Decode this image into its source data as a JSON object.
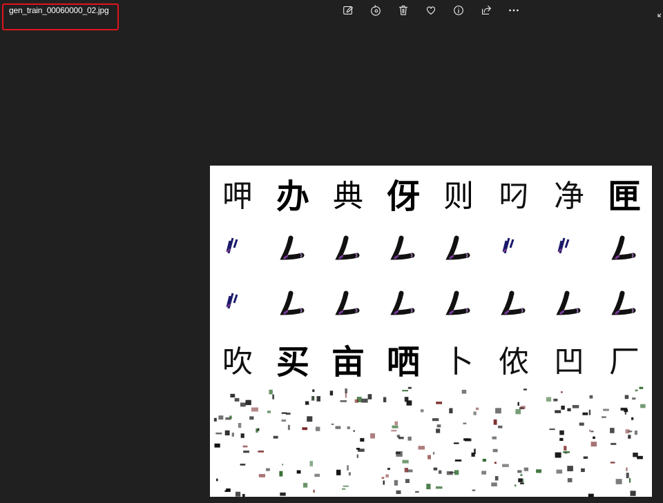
{
  "window": {
    "filename": "gen_train_00060000_02.jpg"
  },
  "toolbar": {
    "buttons": [
      {
        "name": "edit-image-icon"
      },
      {
        "name": "rotate-icon"
      },
      {
        "name": "delete-icon"
      },
      {
        "name": "favorite-heart-icon"
      },
      {
        "name": "info-icon"
      },
      {
        "name": "share-icon"
      },
      {
        "name": "more-options-icon"
      }
    ]
  },
  "image": {
    "rows": [
      [
        "呷",
        "办",
        "典",
        "伢",
        "则",
        "叼",
        "净",
        "匣"
      ],
      [
        "",
        "",
        "",
        "",
        "",
        "",
        "",
        ""
      ],
      [
        "",
        "",
        "",
        "",
        "",
        "",
        "",
        ""
      ],
      [
        "吹",
        "买",
        "亩",
        "哂",
        "卜",
        "侬",
        "凹",
        "厂"
      ]
    ]
  },
  "colors": {
    "background": "#202020",
    "highlight_box": "#e0141e",
    "image_bg": "#ffffff"
  }
}
